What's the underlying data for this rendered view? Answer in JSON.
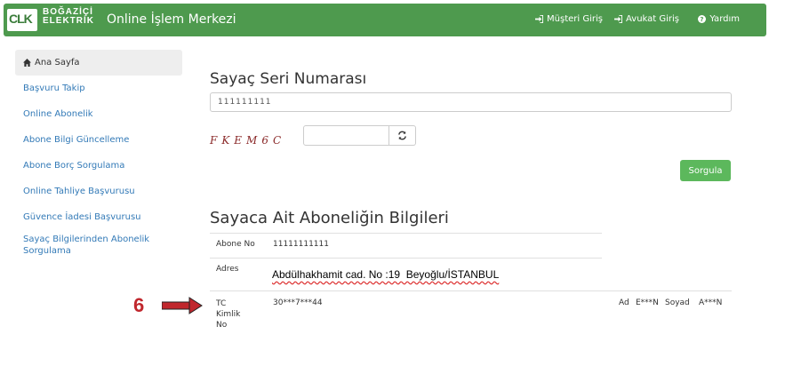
{
  "brand": {
    "logo": "CLK",
    "name_line1": "BOĞAZİÇİ",
    "name_line2": "ELEKTRİK",
    "title": "Online İşlem Merkezi"
  },
  "nav": {
    "customer_login": "Müşteri Giriş",
    "lawyer_login": "Avukat Giriş",
    "help": "Yardım"
  },
  "sidebar": {
    "items": [
      {
        "label": "Ana Sayfa",
        "icon": "home-icon",
        "active": true
      },
      {
        "label": "Başvuru Takip"
      },
      {
        "label": "Online Abonelik"
      },
      {
        "label": "Abone Bilgi Güncelleme"
      },
      {
        "label": "Abone Borç Sorgulama"
      },
      {
        "label": "Online Tahliye Başvurusu"
      },
      {
        "label": "Güvence İadesi Başvurusu"
      },
      {
        "label": "Sayaç Bilgilerinden Abonelik Sorgulama"
      }
    ]
  },
  "form": {
    "heading": "Sayaç Seri Numarası",
    "serial_value": "111111111",
    "captcha": "FKEM6C",
    "captcha_value": "",
    "submit_label": "Sorgula"
  },
  "info": {
    "heading": "Sayaca Ait Aboneliğin Bilgileri",
    "subscriber_no_label": "Abone No",
    "subscriber_no_value": "11111111111",
    "address_label": "Adres",
    "address_value": "Abdülhakhamit cad. No :19  Beyoğlu/İSTANBUL",
    "tc_label": "TC Kimlik No",
    "tc_value": "30***7***44",
    "name_label": "Ad",
    "name_value": "E***N",
    "surname_label": "Soyad",
    "surname_value": "A***N"
  },
  "annotation": {
    "number": "6",
    "color": "#c0272d"
  },
  "colors": {
    "navbar": "#4e9a4e",
    "link": "#337ab7",
    "button": "#5cb85c"
  }
}
